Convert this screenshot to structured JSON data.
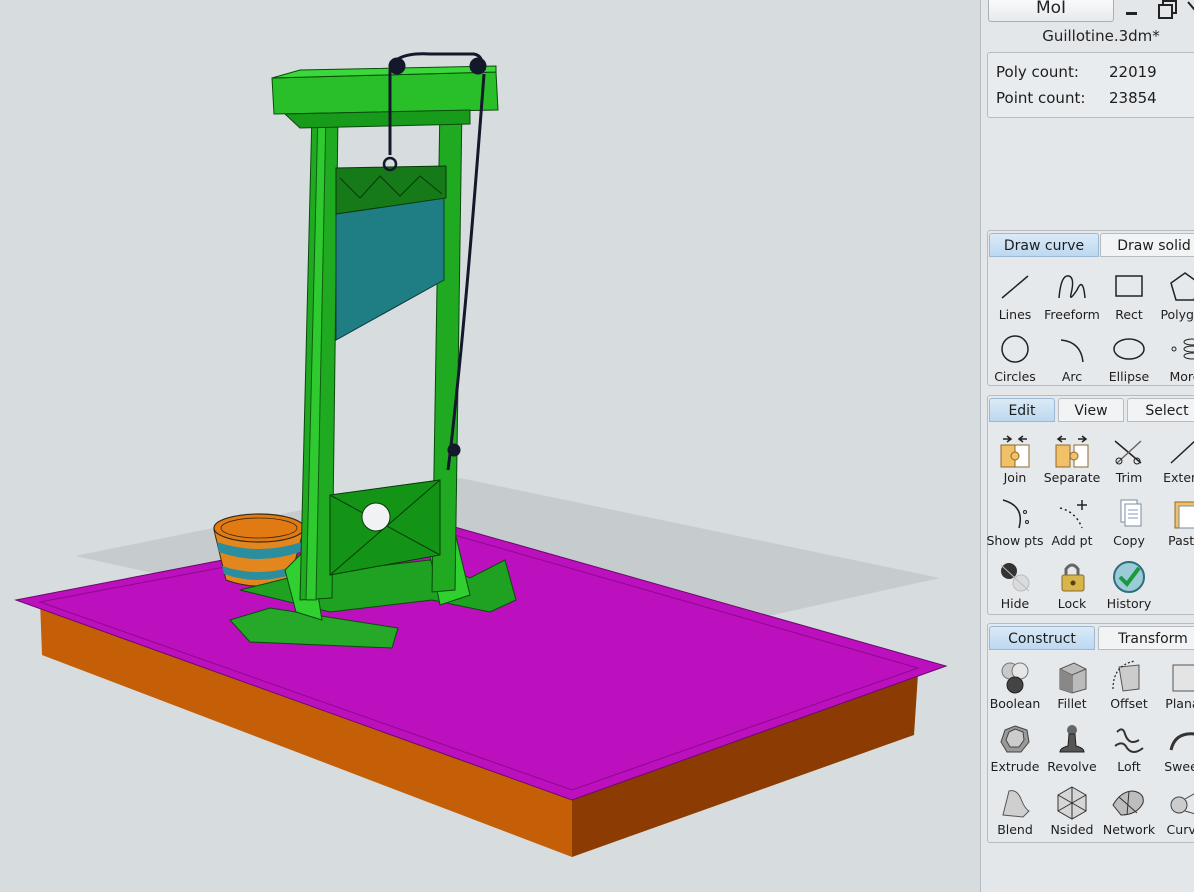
{
  "app": {
    "button_label": "MoI",
    "file_name": "Guillotine.3dm*"
  },
  "stats": [
    {
      "label": "Poly count:",
      "value": "22019"
    },
    {
      "label": "Point count:",
      "value": "23854"
    }
  ],
  "draw": {
    "tabs": [
      "Draw curve",
      "Draw solid"
    ],
    "tools": [
      "Lines",
      "Freeform",
      "Rect",
      "Polygon",
      "Circles",
      "Arc",
      "Ellipse",
      "More"
    ]
  },
  "edit": {
    "tabs": [
      "Edit",
      "View",
      "Select"
    ],
    "tools": [
      "Join",
      "Separate",
      "Trim",
      "Extend",
      "Show pts",
      "Add pt",
      "Copy",
      "Paste",
      "Hide",
      "Lock",
      "History"
    ]
  },
  "construct": {
    "tabs": [
      "Construct",
      "Transform"
    ],
    "tools": [
      "Boolean",
      "Fillet",
      "Offset",
      "Planar",
      "Extrude",
      "Revolve",
      "Loft",
      "Sweep",
      "Blend",
      "Nsided",
      "Network",
      "Curve"
    ]
  },
  "colors": {
    "frame": "#18a81a",
    "base_top": "#bc0fbd",
    "base_side": "#c35a06",
    "blade": "#1f7a7e",
    "accent_tab": "#bcd8f0"
  }
}
